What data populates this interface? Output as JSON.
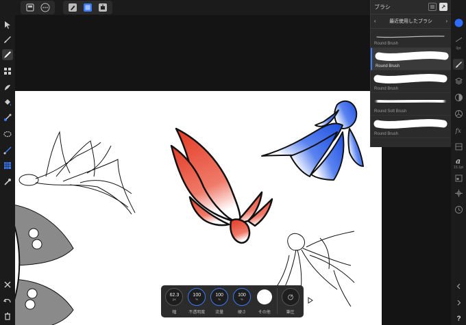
{
  "brush_panel": {
    "title": "ブラシ",
    "category": "最近使用したブラシ",
    "brushes": [
      {
        "label": "Round Brush"
      },
      {
        "label": "Round Brush"
      },
      {
        "label": "Round Brush"
      },
      {
        "label": "Round Soft Brush"
      },
      {
        "label": "Round Brush"
      }
    ]
  },
  "studio": {
    "size_readout": "0pt",
    "font_size_readout": "15.1pt",
    "accent_color": "#3a7afe"
  },
  "context_bar": {
    "width": {
      "value": "62.3",
      "unit": "px",
      "label": "幅"
    },
    "opacity": {
      "value": "100",
      "unit": "%",
      "label": "不透明度"
    },
    "flow": {
      "value": "100",
      "unit": "%",
      "label": "流量"
    },
    "hardness": {
      "value": "100",
      "unit": "%",
      "label": "硬さ"
    },
    "other_label": "その他",
    "stabilizer_label": "筆圧"
  }
}
